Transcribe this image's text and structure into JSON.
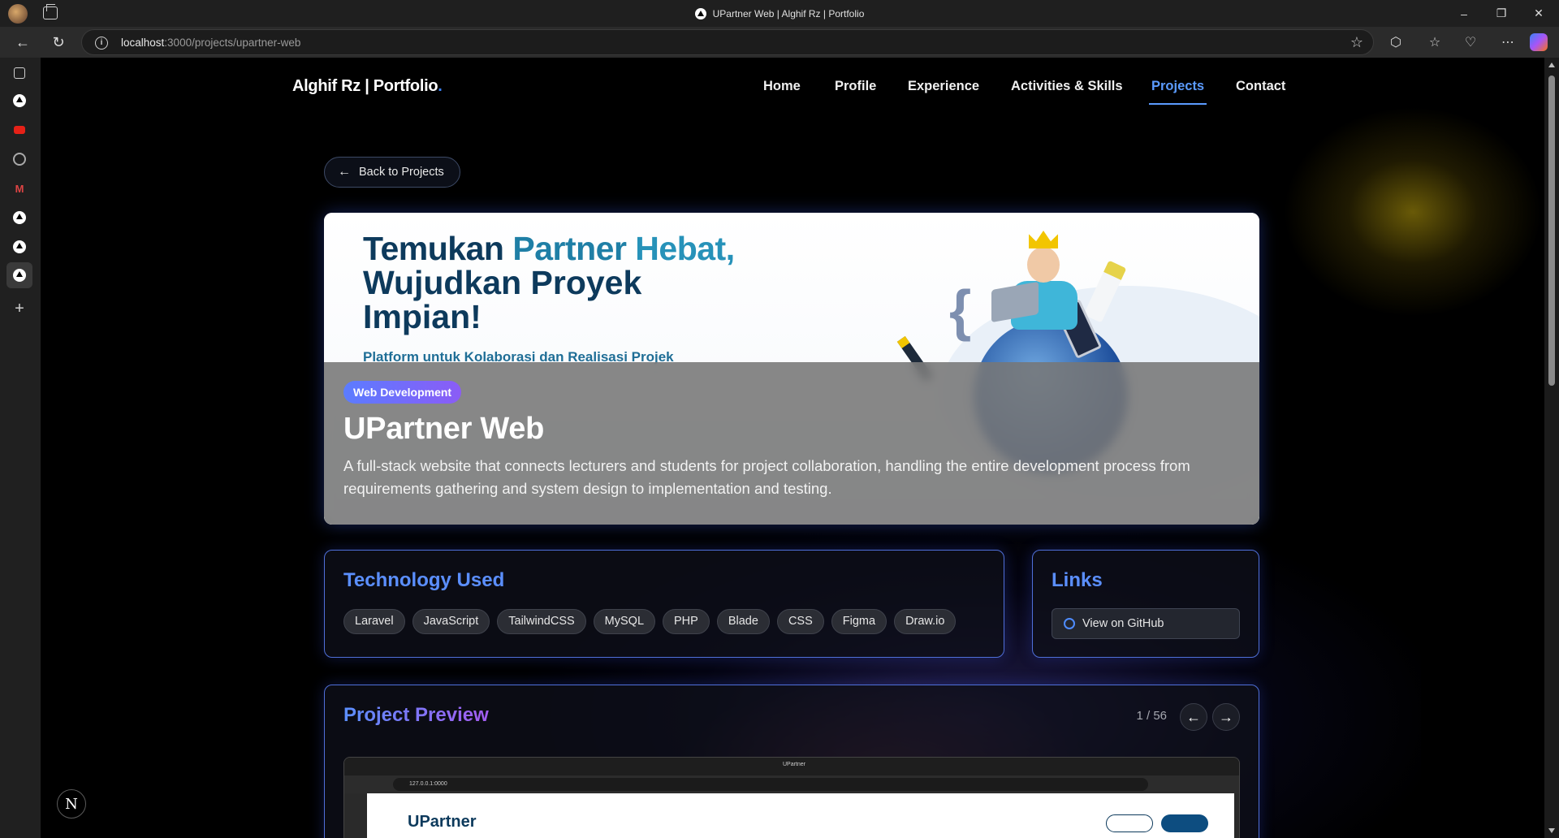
{
  "browser": {
    "window_title": "UPartner Web | Alghif Rz | Portfolio",
    "url_host": "localhost",
    "url_path": ":3000/projects/upartner-web",
    "window_controls": [
      "–",
      "❐",
      "✕"
    ]
  },
  "header": {
    "brand": "Alghif Rz | Portfolio",
    "brand_dot": ".",
    "nav": [
      {
        "label": "Home"
      },
      {
        "label": "Profile"
      },
      {
        "label": "Experience"
      },
      {
        "label": "Activities & Skills"
      },
      {
        "label": "Projects",
        "active": true
      },
      {
        "label": "Contact"
      }
    ]
  },
  "back_button": {
    "label": "Back to Projects"
  },
  "hero": {
    "image_headline_part1": "Temukan ",
    "image_headline_part2": "Partner ",
    "image_headline_part3": "Hebat,",
    "image_headline_line2": "Wujudkan Proyek",
    "image_headline_line3": "Impian!",
    "image_subheadline": "Platform untuk Kolaborasi dan Realisasi Projek",
    "badge": "Web Development",
    "title": "UPartner Web",
    "description": "A full-stack website that connects lecturers and students for project collaboration, handling the entire development process from requirements gathering and system design to implementation and testing."
  },
  "technology": {
    "heading": "Technology Used",
    "items": [
      "Laravel",
      "JavaScript",
      "TailwindCSS",
      "MySQL",
      "PHP",
      "Blade",
      "CSS",
      "Figma",
      "Draw.io"
    ]
  },
  "links": {
    "heading": "Links",
    "github_label": "View on GitHub"
  },
  "preview": {
    "heading": "Project Preview",
    "counter": "1 / 56",
    "prev_arrow": "←",
    "next_arrow": "→",
    "shot_tab_title": "UPartner",
    "shot_url": "127.0.0.1:0000",
    "shot_logo": "UPartner"
  },
  "next_badge": "N",
  "colors": {
    "accent": "#5b9bff",
    "card_border": "#4f6fd9",
    "badge_from": "#5b7cff",
    "badge_to": "#8b5cf6"
  }
}
